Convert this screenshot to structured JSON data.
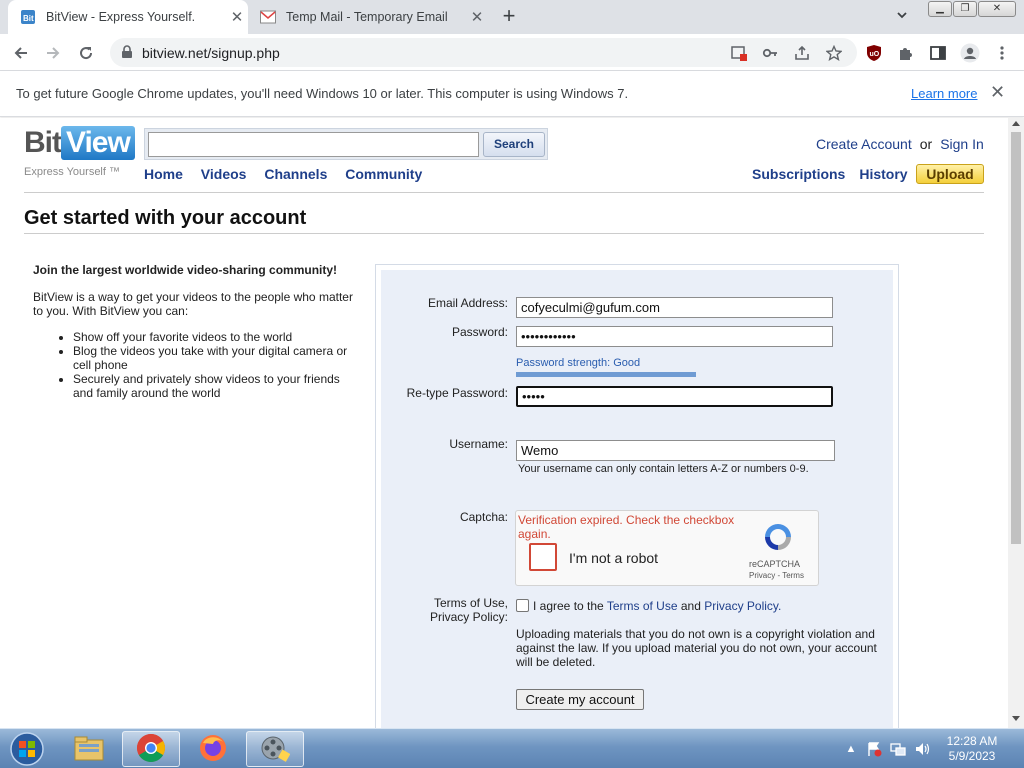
{
  "browser": {
    "tabs": [
      {
        "title": "BitView - Express Yourself.",
        "favicon": "bitview-favicon",
        "active": true
      },
      {
        "title": "Temp Mail - Temporary Email",
        "favicon": "gmail-favicon",
        "active": false
      }
    ],
    "new_tab": "+",
    "url": "bitview.net/signup.php",
    "infobar": {
      "message": "To get future Google Chrome updates, you'll need Windows 10 or later. This computer is using Windows 7.",
      "learn_more": "Learn more"
    }
  },
  "site": {
    "logo_bit": "Bit",
    "logo_view": "View",
    "tagline": "Express Yourself ™",
    "search_button": "Search",
    "nav": [
      "Home",
      "Videos",
      "Channels",
      "Community"
    ],
    "create_account": "Create Account",
    "or": "or",
    "sign_in": "Sign In",
    "subscriptions": "Subscriptions",
    "history": "History",
    "upload": "Upload"
  },
  "page": {
    "title": "Get started with your account",
    "intro_lead": "Join the largest worldwide video-sharing community!",
    "intro_body": "BitView is a way to get your videos to the people who matter to you. With BitView you can:",
    "bullets": [
      "Show off your favorite videos to the world",
      "Blog the videos you take with your digital camera or cell phone",
      "Securely and privately show videos to your friends and family around the world"
    ]
  },
  "form": {
    "email_label": "Email Address:",
    "email_value": "cofyeculmi@gufum.com",
    "password_label": "Password:",
    "password_value": "••••••••••••",
    "strength": "Password strength: Good",
    "strength_level": "Good",
    "retype_label": "Re-type Password:",
    "retype_value": "•••••",
    "username_label": "Username:",
    "username_value": "Wemo",
    "username_hint": "Your username can only contain letters A-Z or numbers 0-9.",
    "captcha_label": "Captcha:",
    "captcha_error": "Verification expired. Check the checkbox again.",
    "captcha_text": "I'm not a robot",
    "captcha_brand": "reCAPTCHA",
    "captcha_links": "Privacy - Terms",
    "terms_label_1": "Terms of Use,",
    "terms_label_2": "Privacy Policy:",
    "terms_agree": "I agree to the ",
    "terms_of_use": "Terms of Use",
    "terms_and": " and ",
    "privacy_policy": "Privacy Policy.",
    "copyright_notice": "Uploading materials that you do not own is a copyright violation and against the law. If you upload material you do not own, your account will be deleted.",
    "submit": "Create my account"
  },
  "taskbar": {
    "time": "12:28 AM",
    "date": "5/9/2023",
    "apps": [
      "windows-explorer",
      "chrome",
      "firefox",
      "media-app"
    ]
  },
  "colors": {
    "link": "#1f3f8a",
    "form_bg": "#eaeff8",
    "error": "#d14836",
    "upload": "#f4cf3b"
  }
}
